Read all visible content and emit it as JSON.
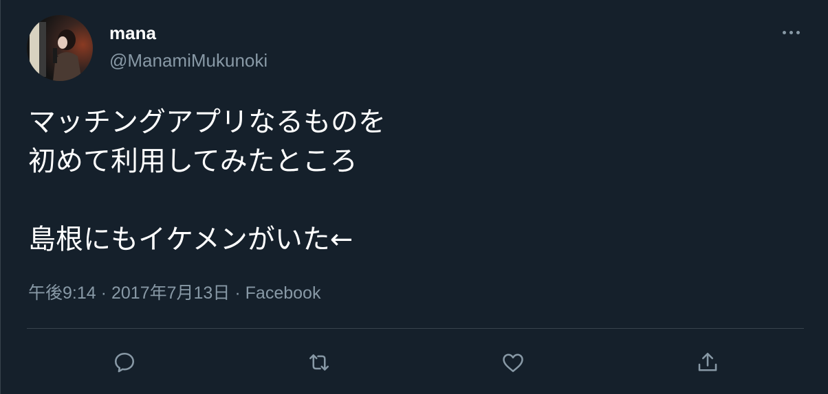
{
  "user": {
    "display_name": "mana",
    "handle": "@ManamiMukunoki",
    "avatar_icon": "profile-photo"
  },
  "tweet": {
    "lines": [
      "マッチングアプリなるものを",
      "初めて利用してみたところ",
      "",
      "島根にもイケメンがいた←"
    ]
  },
  "meta": {
    "time": "午後9:14",
    "separator": "·",
    "date": "2017年7月13日",
    "source": "Facebook"
  },
  "actions": {
    "reply_icon": "reply-icon",
    "retweet_icon": "retweet-icon",
    "like_icon": "heart-icon",
    "share_icon": "share-icon",
    "more_icon": "more-icon"
  },
  "colors": {
    "background": "#15202b",
    "primary_text": "#ffffff",
    "secondary_text": "#8899a6",
    "divider": "#38444d"
  }
}
